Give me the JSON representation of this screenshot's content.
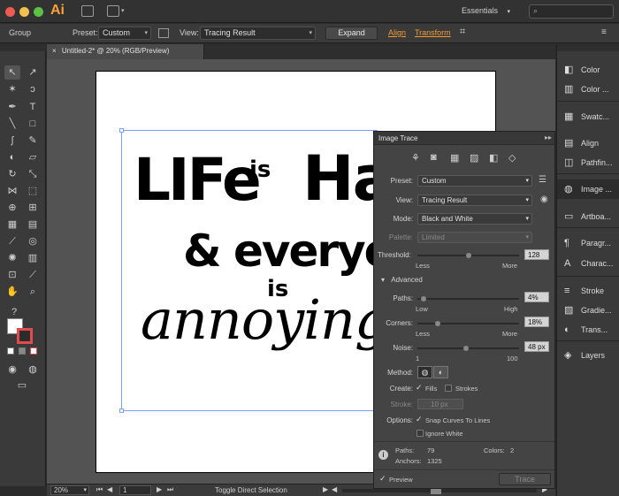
{
  "app": {
    "logo": "Ai",
    "workspace": "Essentials"
  },
  "control_bar": {
    "selection_type": "Group",
    "preset_label": "Preset:",
    "preset_value": "Custom",
    "view_label": "View:",
    "view_value": "Tracing Result",
    "expand_button": "Expand",
    "align_link": "Align",
    "transform_link": "Transform"
  },
  "document": {
    "tab_title": "Untitled-2* @ 20% (RGB/Preview)"
  },
  "status_bar": {
    "zoom": "20%",
    "page": "1",
    "tool_status": "Toggle Direct Selection"
  },
  "image_trace": {
    "title": "Image Trace",
    "preset_label": "Preset:",
    "preset_value": "Custom",
    "view_label": "View:",
    "view_value": "Tracing Result",
    "mode_label": "Mode:",
    "mode_value": "Black and White",
    "palette_label": "Palette:",
    "palette_value": "Limited",
    "threshold_label": "Threshold:",
    "threshold_value": "128",
    "threshold_fraction": 0.5,
    "less": "Less",
    "more": "More",
    "advanced_label": "Advanced",
    "paths_label": "Paths:",
    "paths_value": "4%",
    "paths_fraction": 0.04,
    "low": "Low",
    "high": "High",
    "corners_label": "Corners:",
    "corners_value": "18%",
    "corners_fraction": 0.18,
    "noise_label": "Noise:",
    "noise_value": "48 px",
    "noise_fraction": 0.48,
    "noise_min": "1",
    "noise_max": "100",
    "method_label": "Method:",
    "create_label": "Create:",
    "fills_label": "Fills",
    "fills_checked": true,
    "strokes_label": "Strokes",
    "strokes_checked": false,
    "stroke_label": "Stroke:",
    "stroke_value": "10 px",
    "options_label": "Options:",
    "snap_label": "Snap Curves To Lines",
    "snap_checked": true,
    "ignore_white_label": "Ignore White",
    "ignore_white_checked": false,
    "paths_stat_label": "Paths:",
    "paths_stat_value": "79",
    "colors_stat_label": "Colors:",
    "colors_stat_value": "2",
    "anchors_stat_label": "Anchors:",
    "anchors_stat_value": "1325",
    "preview_label": "Preview",
    "preview_checked": true,
    "trace_button": "Trace"
  },
  "artwork": {
    "line1": "LIFe",
    "line1b": "is",
    "line1c": "Ha",
    "line2": "& everyo",
    "line3": "is",
    "line4": "annoying"
  },
  "dock": [
    {
      "label": "Color",
      "icon": "color-icon"
    },
    {
      "label": "Color ...",
      "icon": "color-guide-icon"
    },
    {
      "label": "Swatc...",
      "icon": "swatches-icon"
    },
    {
      "label": "Align",
      "icon": "align-icon"
    },
    {
      "label": "Pathfin...",
      "icon": "pathfinder-icon"
    },
    {
      "label": "Image ...",
      "icon": "image-trace-icon"
    },
    {
      "label": "Artboa...",
      "icon": "artboards-icon"
    },
    {
      "label": "Paragr...",
      "icon": "paragraph-icon"
    },
    {
      "label": "Charac...",
      "icon": "character-icon"
    },
    {
      "label": "Stroke",
      "icon": "stroke-icon"
    },
    {
      "label": "Gradie...",
      "icon": "gradient-icon"
    },
    {
      "label": "Trans...",
      "icon": "transparency-icon"
    },
    {
      "label": "Layers",
      "icon": "layers-icon"
    }
  ],
  "colors": {
    "accent_orange": "#f39c32",
    "close_red": "#ee5a52",
    "minimize_yellow": "#f4bf4f",
    "zoom_green": "#5dc144"
  }
}
